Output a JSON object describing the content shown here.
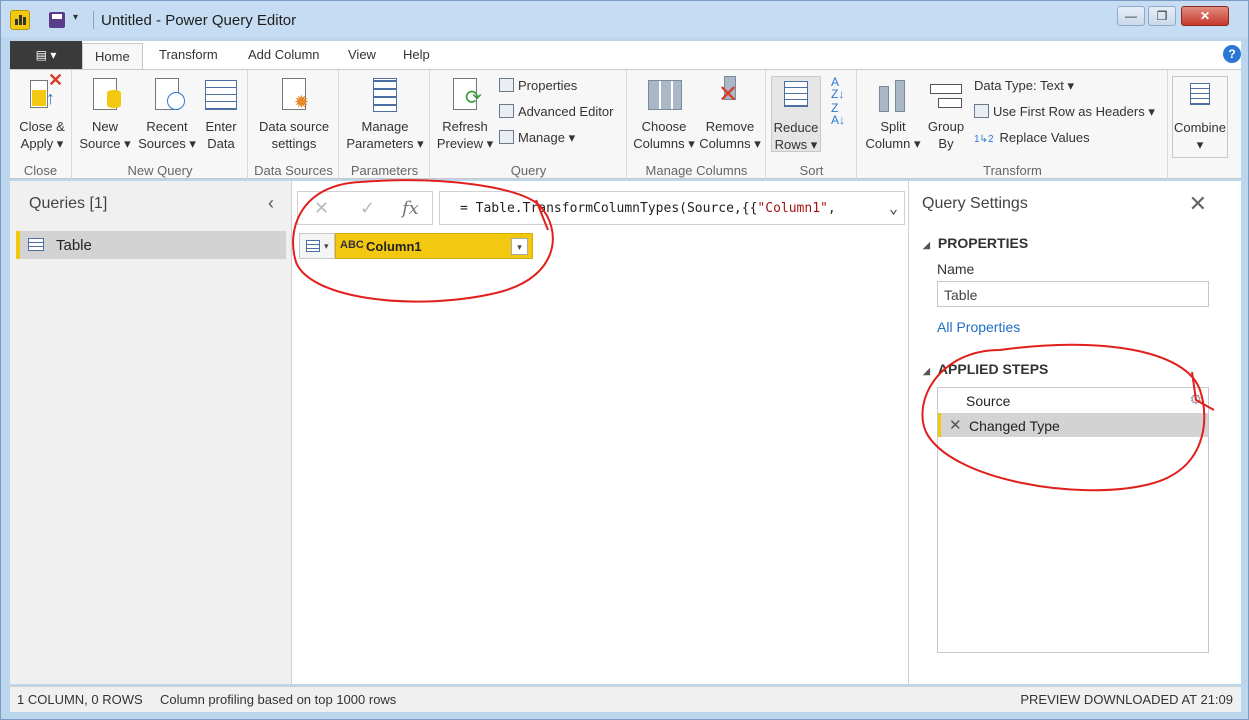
{
  "window": {
    "title": "Untitled - Power Query Editor",
    "minimize": "—",
    "maximize": "❐",
    "close": "✕"
  },
  "quick_access": {
    "dropdown": "▾"
  },
  "ribbon_tabs": {
    "file": "▤ ▾",
    "home": "Home",
    "transform": "Transform",
    "add_column": "Add Column",
    "view": "View",
    "help": "Help",
    "help_icon": "?"
  },
  "groups": {
    "close": "Close",
    "new_query": "New Query",
    "data_sources": "Data Sources",
    "parameters": "Parameters",
    "query": "Query",
    "manage_columns": "Manage Columns",
    "sort": "Sort",
    "transform": "Transform"
  },
  "buttons": {
    "close_apply": [
      "Close &",
      "Apply ▾"
    ],
    "new_source": [
      "New",
      "Source ▾"
    ],
    "recent_sources": [
      "Recent",
      "Sources ▾"
    ],
    "enter_data": [
      "Enter",
      "Data"
    ],
    "data_source_settings": [
      "Data source",
      "settings"
    ],
    "manage_parameters": [
      "Manage",
      "Parameters ▾"
    ],
    "refresh_preview": [
      "Refresh",
      "Preview ▾"
    ],
    "properties": "Properties",
    "advanced_editor": "Advanced Editor",
    "manage": "Manage ▾",
    "choose_columns": [
      "Choose",
      "Columns ▾"
    ],
    "remove_columns": [
      "Remove",
      "Columns ▾"
    ],
    "reduce_rows": [
      "Reduce",
      "Rows ▾"
    ],
    "split_column": [
      "Split",
      "Column ▾"
    ],
    "group_by": [
      "Group",
      "By"
    ],
    "data_type": "Data Type: Text ▾",
    "first_row_headers": "Use First Row as Headers ▾",
    "replace_values": "Replace Values",
    "combine": [
      "Combine",
      "▾"
    ]
  },
  "queries_pane": {
    "title": "Queries [1]",
    "collapse": "‹",
    "items": [
      {
        "label": "Table"
      }
    ]
  },
  "formula_bar": {
    "cancel": "✕",
    "commit": "✓",
    "fx": "fx",
    "prefix": "= Table.TransformColumnTypes(Source,{{",
    "string": "\"Column1\"",
    "suffix": ",",
    "expand": "⌄"
  },
  "grid": {
    "column": {
      "type": "ABC",
      "name": "Column1",
      "dropdown": "▾"
    }
  },
  "query_settings": {
    "title": "Query Settings",
    "close": "✕",
    "properties_header": "PROPERTIES",
    "name_label": "Name",
    "name_value": "Table",
    "all_properties": "All Properties",
    "applied_steps_header": "APPLIED STEPS",
    "steps": [
      {
        "label": "Source",
        "gear": "⚙"
      },
      {
        "label": "Changed Type",
        "delete": "✕"
      }
    ]
  },
  "status": {
    "left": "1 COLUMN, 0 ROWS",
    "profiling": "Column profiling based on top 1000 rows",
    "right": "PREVIEW DOWNLOADED AT 21:09"
  },
  "colors": {
    "accent_yellow": "#f2c811",
    "annotation_red": "#e0201c",
    "link_blue": "#1e6fc7"
  }
}
